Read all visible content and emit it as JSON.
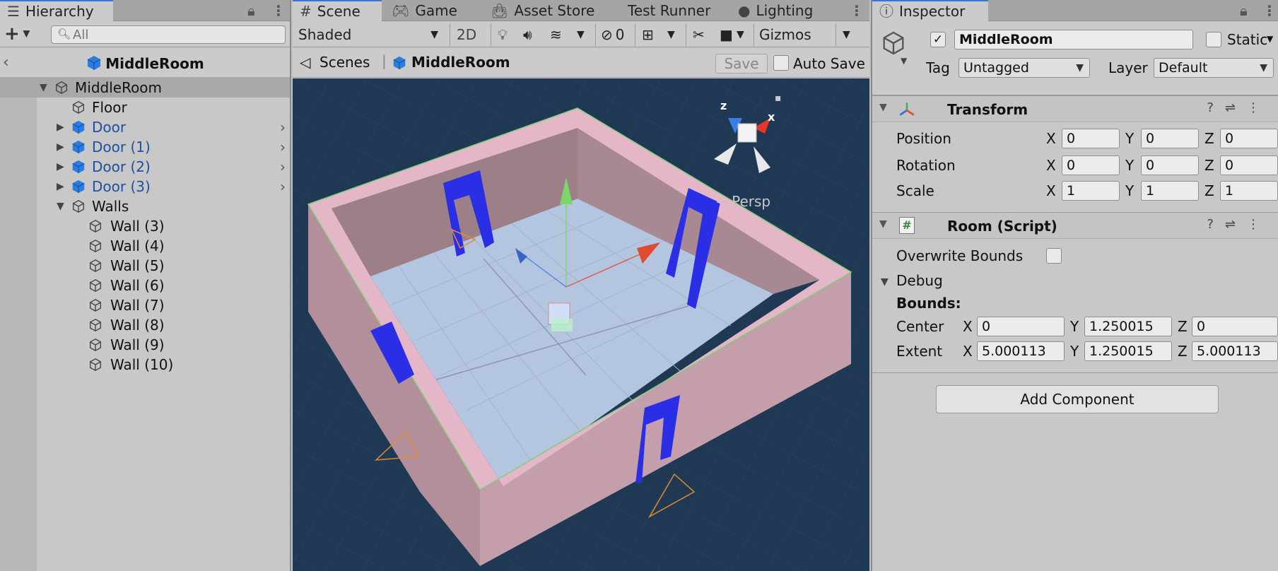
{
  "hierarchy": {
    "tab_label": "Hierarchy",
    "search_placeholder": "All",
    "header_title": "MiddleRoom",
    "items": [
      {
        "label": "MiddleRoom"
      },
      {
        "label": "Floor"
      },
      {
        "label": "Door"
      },
      {
        "label": "Door (1)"
      },
      {
        "label": "Door (2)"
      },
      {
        "label": "Door (3)"
      },
      {
        "label": "Walls"
      },
      {
        "label": "Wall (3)"
      },
      {
        "label": "Wall (4)"
      },
      {
        "label": "Wall (5)"
      },
      {
        "label": "Wall (6)"
      },
      {
        "label": "Wall (7)"
      },
      {
        "label": "Wall (8)"
      },
      {
        "label": "Wall (9)"
      },
      {
        "label": "Wall (10)"
      }
    ]
  },
  "scene": {
    "tabs": [
      "Scene",
      "Game",
      "Asset Store",
      "Test Runner",
      "Lighting"
    ],
    "toolbar": {
      "shading": "Shaded",
      "mode_2d": "2D",
      "hidden_count": "0",
      "gizmos": "Gizmos"
    },
    "breadcrumb": {
      "scenes": "Scenes",
      "current": "MiddleRoom",
      "save": "Save",
      "auto_save": "Auto Save"
    },
    "gizmo": {
      "z": "z",
      "x": "x",
      "persp": "Persp"
    }
  },
  "inspector": {
    "tab_label": "Inspector",
    "object_name": "MiddleRoom",
    "static_label": "Static",
    "tag_label": "Tag",
    "tag_value": "Untagged",
    "layer_label": "Layer",
    "layer_value": "Default",
    "transform": {
      "title": "Transform",
      "position": {
        "label": "Position",
        "x": "0",
        "y": "0",
        "z": "0"
      },
      "rotation": {
        "label": "Rotation",
        "x": "0",
        "y": "0",
        "z": "0"
      },
      "scale": {
        "label": "Scale",
        "x": "1",
        "y": "1",
        "z": "1"
      }
    },
    "room_script": {
      "title": "Room (Script)",
      "overwrite_bounds": "Overwrite Bounds",
      "debug": "Debug",
      "bounds": "Bounds:",
      "center": {
        "label": "Center",
        "x": "0",
        "y": "1.250015",
        "z": "0"
      },
      "extent": {
        "label": "Extent",
        "x": "5.000113",
        "y": "1.250015",
        "z": "5.000113"
      }
    },
    "axis": {
      "x": "X",
      "y": "Y",
      "z": "Z"
    },
    "add_component": "Add Component"
  }
}
